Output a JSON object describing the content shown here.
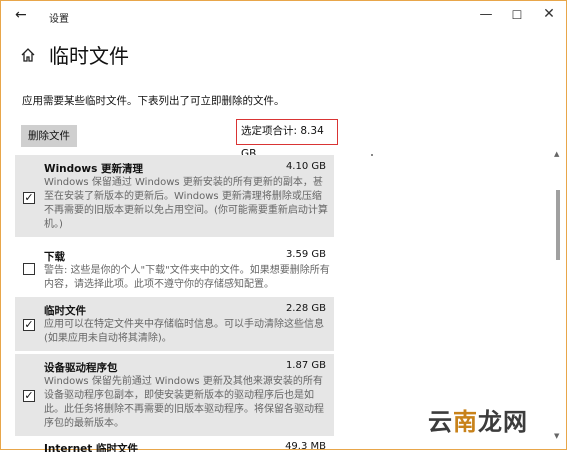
{
  "window": {
    "title": "设置",
    "back_glyph": "←",
    "min_glyph": "—",
    "max_glyph": "☐",
    "close_glyph": "✕"
  },
  "page": {
    "title": "临时文件",
    "description": "应用需要某些临时文件。下表列出了可立即删除的文件。",
    "remove_button": "删除文件",
    "total_selected": "选定项合计: 8.34 GB"
  },
  "items": [
    {
      "name": "Windows 更新清理",
      "size": "4.10 GB",
      "checked": true,
      "detail": "Windows 保留通过 Windows 更新安装的所有更新的副本，甚至在安装了新版本的更新后。Windows 更新清理将删除或压缩不再需要的旧版本更新以免占用空间。(你可能需要重新启动计算机。)"
    },
    {
      "name": "下载",
      "size": "3.59 GB",
      "checked": false,
      "detail": "警告: 这些是你的个人\"下载\"文件夹中的文件。如果想要删除所有内容，请选择此项。此项不遵守你的存储感知配置。"
    },
    {
      "name": "临时文件",
      "size": "2.28 GB",
      "checked": true,
      "detail": "应用可以在特定文件夹中存储临时信息。可以手动清除这些信息(如果应用未自动将其清除)。"
    },
    {
      "name": "设备驱动程序包",
      "size": "1.87 GB",
      "checked": true,
      "detail": "Windows 保留先前通过 Windows 更新及其他来源安装的所有设备驱动程序包副本，即使安装更新版本的驱动程序后也是如此。此任务将删除不再需要的旧版本驱动程序。将保留各驱动程序包的最新版本。"
    },
    {
      "name": "Internet 临时文件",
      "size": "49.3 MB",
      "checked": false,
      "detail": ""
    }
  ],
  "watermark": {
    "part1": "云",
    "part2": "南",
    "part3": "龙网"
  },
  "icons": {
    "home": "home-icon",
    "checkbox": "checkbox-icon"
  }
}
